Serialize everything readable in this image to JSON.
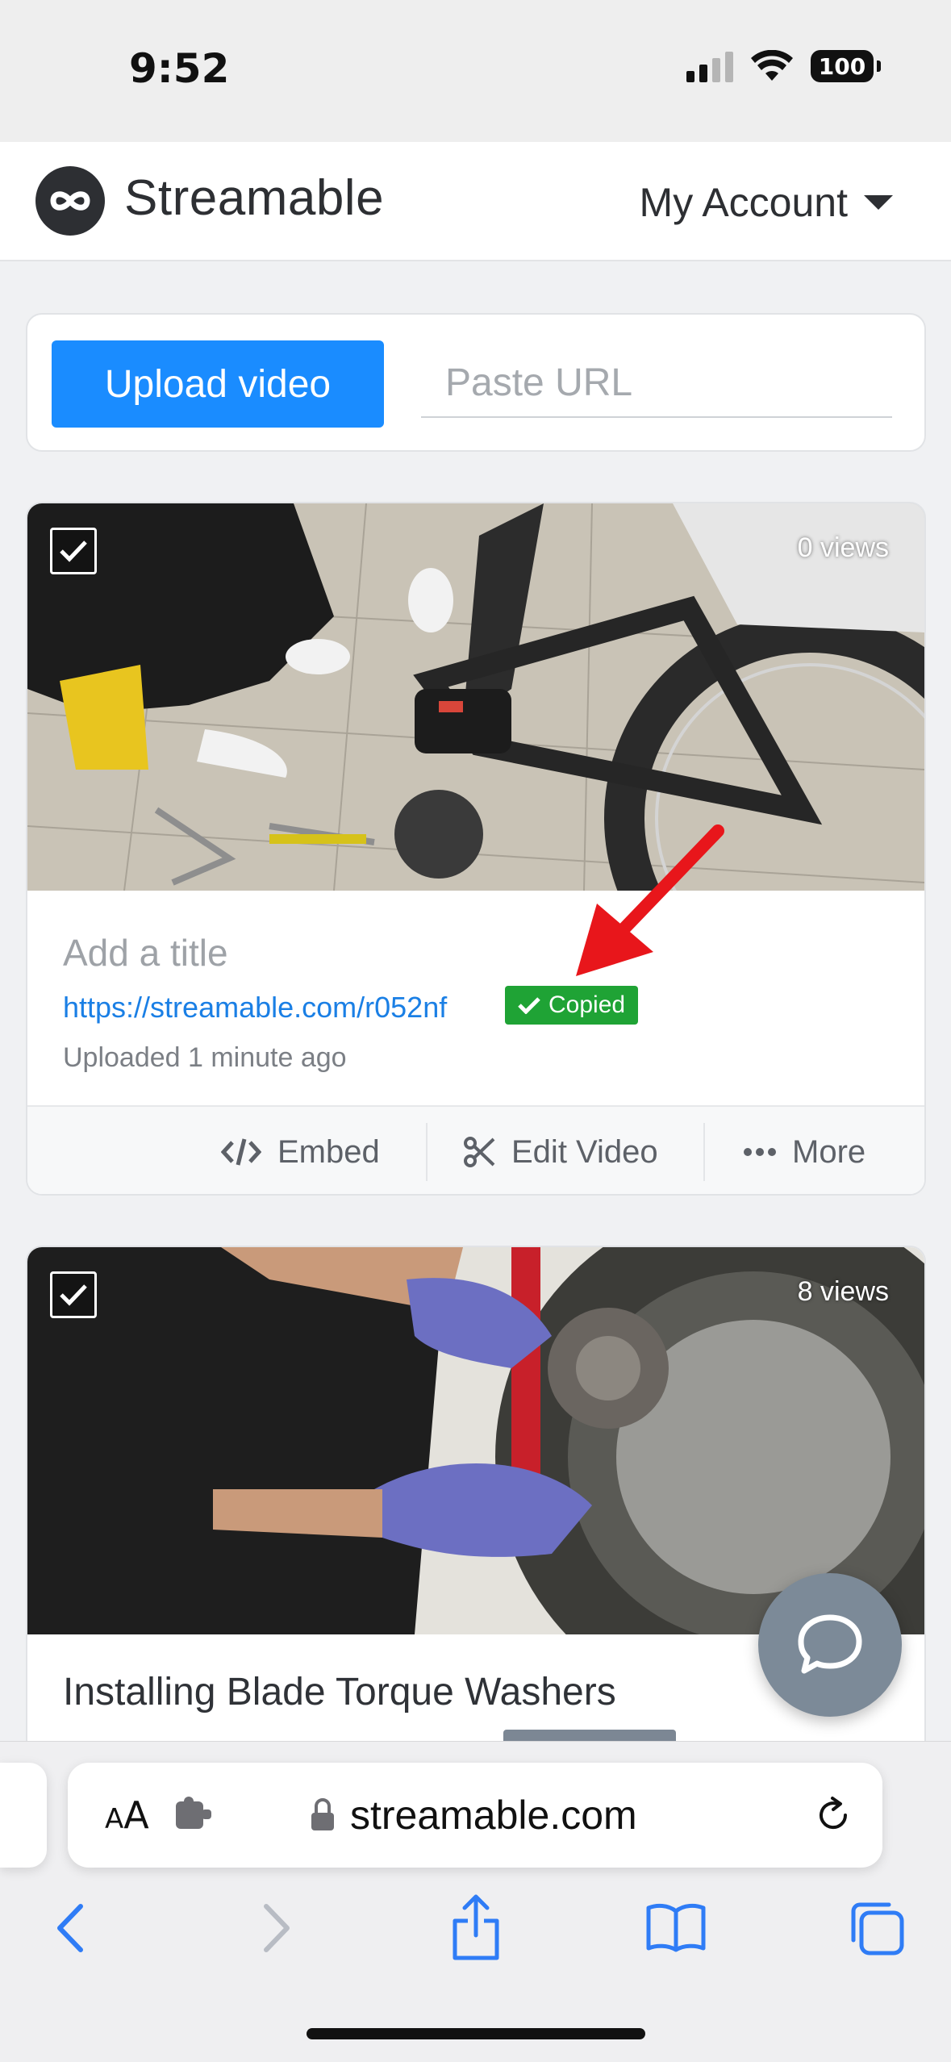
{
  "status_bar": {
    "time": "9:52",
    "battery": "100",
    "icons": [
      "cellular-signal-icon",
      "wifi-icon",
      "battery-icon"
    ]
  },
  "header": {
    "brand": "Streamable",
    "account_label": "My Account",
    "icons": [
      "streamable-logo-icon",
      "caret-down-icon"
    ]
  },
  "upload": {
    "button_label": "Upload video",
    "url_placeholder": "Paste URL"
  },
  "videos": [
    {
      "views": "0 views",
      "title_placeholder": "Add a title",
      "link": "https://streamable.com/r052nf",
      "copied_label": "Copied",
      "uploaded": "Uploaded 1 minute ago",
      "actions": {
        "embed": "Embed",
        "edit": "Edit Video",
        "more": "More"
      }
    },
    {
      "views": "8 views",
      "title": "Installing Blade Torque Washers"
    }
  ],
  "safari": {
    "text_size_label": "AA",
    "domain": "streamable.com",
    "toolbar_icons": [
      "back-icon",
      "forward-icon",
      "share-icon",
      "bookmarks-icon",
      "tabs-icon"
    ]
  },
  "colors": {
    "accent": "#1a8cff",
    "copied_green": "#1fa335",
    "link_blue": "#1a7fe5",
    "chat_bubble": "#7c8a98",
    "annotation_arrow": "#e8161b"
  }
}
